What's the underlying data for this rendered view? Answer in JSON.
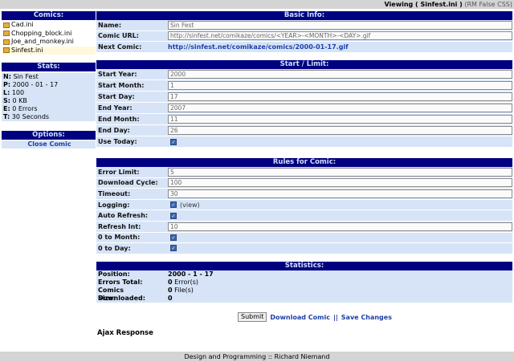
{
  "topbar": {
    "viewing": "Viewing ( Sinfest.ini )",
    "mode": "(RM False CSS)"
  },
  "comics": {
    "title": "Comics:",
    "items": [
      "Cad.ini",
      "Chopping_block.ini",
      "Joe_and_monkey.ini",
      "Sinfest.ini"
    ],
    "selected": 3
  },
  "stats": {
    "title": "Stats:",
    "items": [
      {
        "k": "N:",
        "v": "Sin Fest"
      },
      {
        "k": "P:",
        "v": "2000 - 01 - 17"
      },
      {
        "k": "L:",
        "v": "100"
      },
      {
        "k": "S:",
        "v": "0 KB"
      },
      {
        "k": "E:",
        "v": "0 Errors"
      },
      {
        "k": "T:",
        "v": "30 Seconds"
      }
    ]
  },
  "options": {
    "title": "Options:",
    "close": "Close Comic"
  },
  "basic": {
    "title": "Basic Info:",
    "rows": [
      {
        "label": "Name:",
        "type": "input",
        "value": "Sin Fest"
      },
      {
        "label": "Comic URL:",
        "type": "input",
        "value": "http://sinfest.net/comikaze/comics/<YEAR>-<MONTH>-<DAY>.gif"
      },
      {
        "label": "Next Comic:",
        "type": "link",
        "value": "http://sinfest.net/comikaze/comics/2000-01-17.gif"
      }
    ]
  },
  "start": {
    "title": "Start / Limit:",
    "rows": [
      {
        "label": "Start Year:",
        "type": "input",
        "value": "2000"
      },
      {
        "label": "Start Month:",
        "type": "input",
        "value": "1"
      },
      {
        "label": "Start Day:",
        "type": "input",
        "value": "17"
      },
      {
        "label": "End Year:",
        "type": "input",
        "value": "2007"
      },
      {
        "label": "End Month:",
        "type": "input",
        "value": "11"
      },
      {
        "label": "End Day:",
        "type": "input",
        "value": "26"
      },
      {
        "label": "Use Today:",
        "type": "check",
        "value": true
      }
    ]
  },
  "rules": {
    "title": "Rules for Comic:",
    "rows": [
      {
        "label": "Error Limit:",
        "type": "input",
        "value": "5"
      },
      {
        "label": "Download Cycle:",
        "type": "input",
        "value": "100"
      },
      {
        "label": "Timeout:",
        "type": "input",
        "value": "30"
      },
      {
        "label": "Logging:",
        "type": "check",
        "value": true,
        "extra": "(view)"
      },
      {
        "label": "Auto Refresh:",
        "type": "check",
        "value": true
      },
      {
        "label": "Refresh Int:",
        "type": "input",
        "value": "10"
      },
      {
        "label": "0 to Month:",
        "type": "check",
        "value": true
      },
      {
        "label": "0 to Day:",
        "type": "check",
        "value": true
      }
    ]
  },
  "statistics": {
    "title": "Statistics:",
    "rows": [
      {
        "label": "Position:",
        "bold": "2000 - 1 - 17",
        "rest": ""
      },
      {
        "label": "Errors Total:",
        "bold": "0",
        "rest": " Error(s)"
      },
      {
        "label": "Comics Downloaded:",
        "bold": "0",
        "rest": " File(s)"
      },
      {
        "label": "Size:",
        "bold": "0",
        "rest": ""
      }
    ]
  },
  "actions": {
    "submit": "Submit",
    "download": "Download Comic",
    "sep": "||",
    "save": "Save Changes"
  },
  "ajax": "Ajax Response",
  "footer": "Design and Programming :: Richard Niemand"
}
